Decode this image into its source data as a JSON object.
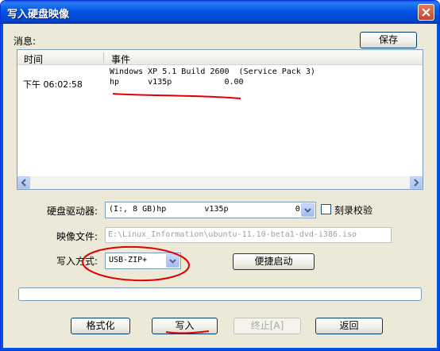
{
  "window": {
    "title": "写入硬盘映像"
  },
  "messages": {
    "label": "消息:",
    "save_button": "保存",
    "columns": [
      "时间",
      "事件"
    ],
    "rows": [
      {
        "time": "下午 06:02:58",
        "event_lines": [
          "Windows XP 5.1 Build 2600  (Service Pack 3)",
          "hp      v135p           0.00"
        ]
      }
    ]
  },
  "disk_drive": {
    "label": "硬盘驱动器:",
    "value": "(I:, 8 GB)hp        v135p              0.00"
  },
  "verify": {
    "label": "刻录校验",
    "checked": false
  },
  "image_file": {
    "label": "映像文件:",
    "value": "E:\\Linux_Information\\ubuntu-11.10-beta1-dvd-i386.iso"
  },
  "write_method": {
    "label": "写入方式:",
    "value": "USB-ZIP+"
  },
  "quick_boot_button": "便捷启动",
  "progress": {
    "fraction": 0
  },
  "buttons": {
    "format": "格式化",
    "write": "写入",
    "abort": "终止[A]",
    "back": "返回"
  },
  "colors": {
    "title_bar": "#0054e3",
    "window_bg": "#ece9d8",
    "annotation": "#e00000"
  }
}
